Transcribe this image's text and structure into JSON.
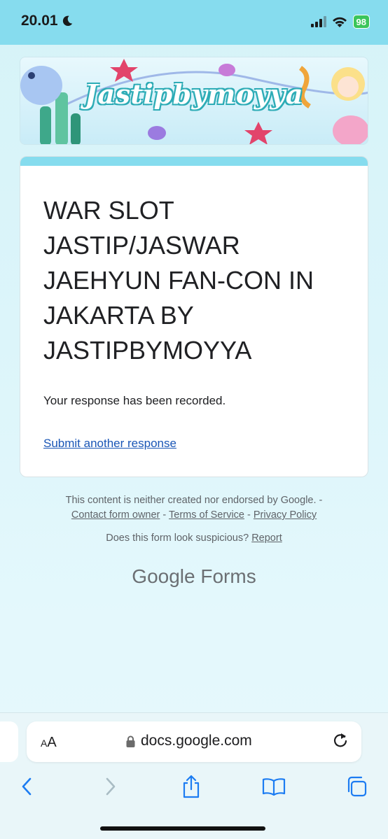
{
  "status": {
    "time": "20.01",
    "battery": "98"
  },
  "banner": {
    "title": "Jastipbymoyya"
  },
  "card": {
    "title": "WAR SLOT JASTIP/JASWAR JAEHYUN FAN-CON IN JAKARTA BY JASTIPBYMOYYA",
    "recorded": "Your response has been recorded.",
    "submit_another": "Submit another response"
  },
  "footer": {
    "disclaimer": "This content is neither created nor endorsed by Google. -",
    "contact": "Contact form owner",
    "sep1": " - ",
    "terms": "Terms of Service",
    "sep2": " - ",
    "privacy": "Privacy Policy",
    "suspicious": "Does this form look suspicious?",
    "report": "Report",
    "brand_google": "Google",
    "brand_forms": "Forms"
  },
  "browser": {
    "aa": "A",
    "aa_big": "A",
    "url": "docs.google.com"
  },
  "colors": {
    "accent": "#86dcee",
    "link": "#1a56b6",
    "ios_blue": "#1c7cf2"
  },
  "icons": [
    "moon-icon",
    "signal-icon",
    "wifi-icon",
    "battery-icon",
    "lock-icon",
    "reload-icon",
    "back-icon",
    "forward-icon",
    "share-icon",
    "bookmarks-icon",
    "tabs-icon"
  ]
}
